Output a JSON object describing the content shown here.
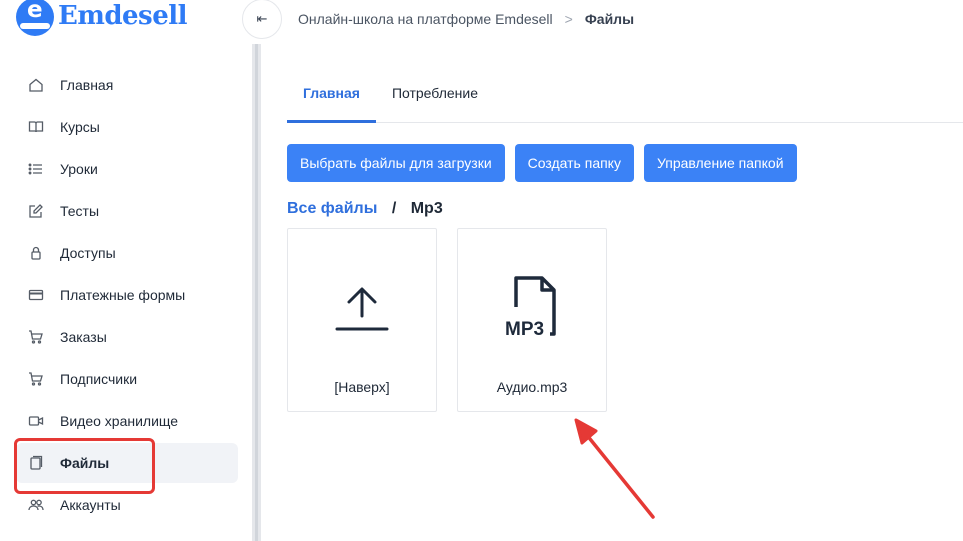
{
  "brand": {
    "name": "Emdesell",
    "badge_letter": "e",
    "color": "#2f7bf5"
  },
  "breadcrumbs": {
    "collapse_glyph": "⇤",
    "items": [
      "Онлайн-школа на платформе Emdesell",
      "Файлы"
    ],
    "separator": ">"
  },
  "sidebar": {
    "items": [
      {
        "label": "Главная",
        "icon": "home-icon",
        "active": false
      },
      {
        "label": "Курсы",
        "icon": "book-icon",
        "active": false
      },
      {
        "label": "Уроки",
        "icon": "list-icon",
        "active": false
      },
      {
        "label": "Тесты",
        "icon": "edit-icon",
        "active": false
      },
      {
        "label": "Доступы",
        "icon": "lock-icon",
        "active": false
      },
      {
        "label": "Платежные формы",
        "icon": "card-icon",
        "active": false
      },
      {
        "label": "Заказы",
        "icon": "cart-icon",
        "active": false
      },
      {
        "label": "Подписчики",
        "icon": "cart-icon",
        "active": false
      },
      {
        "label": "Видео хранилище",
        "icon": "video-icon",
        "active": false
      },
      {
        "label": "Файлы",
        "icon": "file-icon",
        "active": true
      },
      {
        "label": "Аккаунты",
        "icon": "users-icon",
        "active": false
      }
    ]
  },
  "tabs": [
    {
      "label": "Главная",
      "active": true
    },
    {
      "label": "Потребление",
      "active": false
    }
  ],
  "toolbar": {
    "upload_label": "Выбрать файлы для загрузки",
    "create_folder_label": "Создать папку",
    "manage_folder_label": "Управление папкой"
  },
  "path": {
    "root": "Все файлы",
    "separator": "/",
    "current": "Mp3"
  },
  "files": [
    {
      "label": "[Наверх]",
      "icon": "upload-icon"
    },
    {
      "label": "Аудио.mp3",
      "icon": "mp3-file-icon",
      "icon_text": "MP3"
    }
  ],
  "colors": {
    "accent": "#3b82f6",
    "link": "#2f6fdd",
    "annotation": "#e53935"
  }
}
